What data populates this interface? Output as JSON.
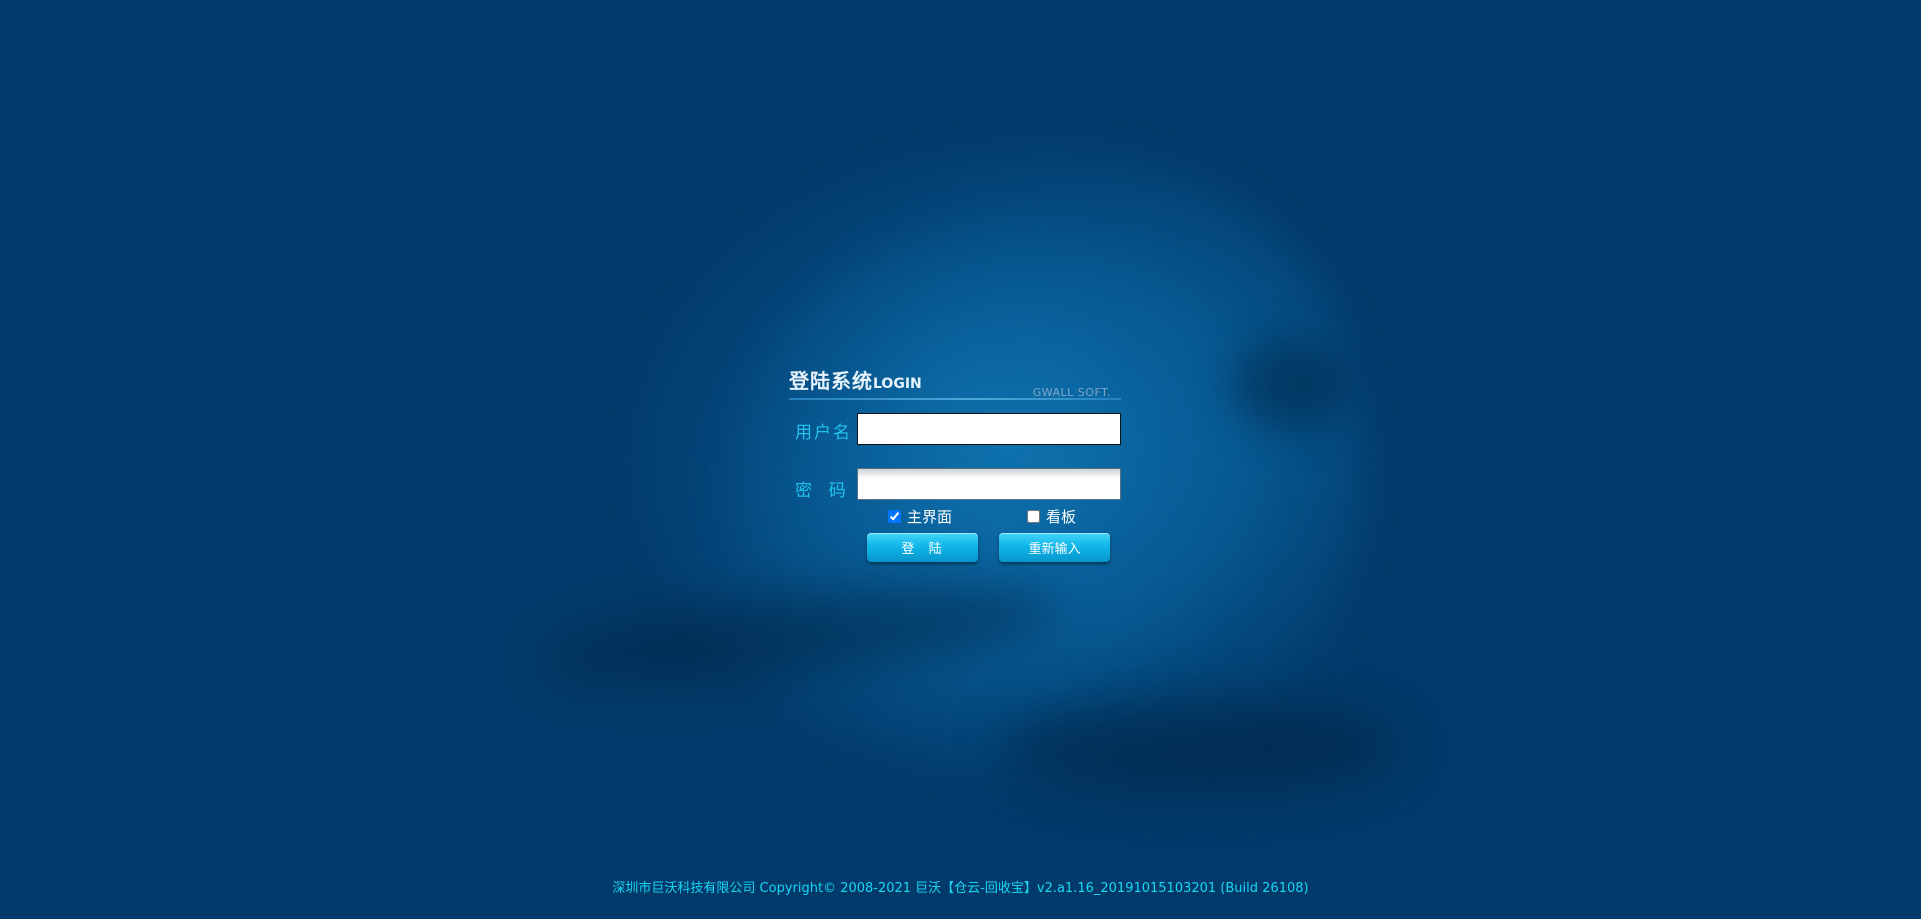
{
  "login": {
    "title_cn": "登陆系统",
    "title_en": "LOGIN",
    "brand": "GWALL SOFT.",
    "username_label": "用户名",
    "username_value": "",
    "password_label": "密  码",
    "password_value": "",
    "options": [
      {
        "label": "主界面",
        "checked": true
      },
      {
        "label": "看板",
        "checked": false
      }
    ],
    "login_button": "登  陆",
    "reset_button": "重新输入"
  },
  "footer": {
    "text": "深圳市巨沃科技有限公司 Copyright© 2008-2021 巨沃【仓云-回收宝】v2.a1.16_20191015103201 (Build 26108)"
  },
  "colors": {
    "background": "#023b6b",
    "label": "#22c3ee",
    "button": "#10b6ea",
    "footer_text": "#19d6f2"
  }
}
